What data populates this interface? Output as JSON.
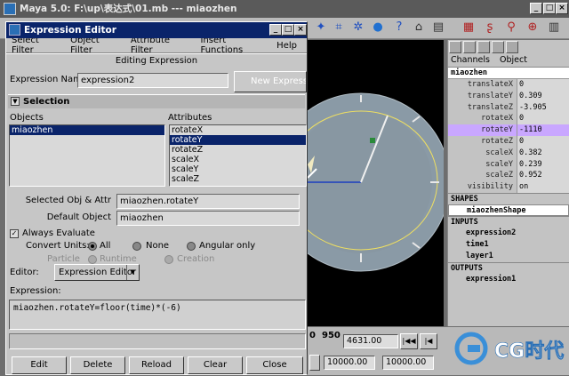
{
  "maya": {
    "title": "Maya 5.0: F:\\up\\表达式\\01.mb  ---  miaozhen",
    "win_buttons": [
      "_",
      "□",
      "×"
    ]
  },
  "toolbar_icons": [
    "object-icon",
    "render-icon",
    "graph-icon",
    "spider-icon",
    "sphere-icon",
    "light-icon",
    "help-icon",
    "reference-icon",
    "outliner-icon",
    "grid-icon",
    "channel-icon",
    "curve-icon",
    "camera-icon"
  ],
  "expression_editor": {
    "title": "Expression Editor",
    "menu": [
      "Select Filter",
      "Object Filter",
      "Attribute Filter",
      "Insert Functions",
      "Help"
    ],
    "mode_heading": "Editing Expression",
    "expression_name_label": "Expression Name",
    "expression_name_value": "expression2",
    "new_expression_button": "New Expression",
    "selection_label": "Selection",
    "objects_label": "Objects",
    "attributes_label": "Attributes",
    "objects": [
      {
        "name": "miaozhen",
        "selected": true
      }
    ],
    "attributes": [
      {
        "name": "rotateX",
        "selected": false
      },
      {
        "name": "rotateY",
        "selected": true
      },
      {
        "name": "rotateZ",
        "selected": false
      },
      {
        "name": "scaleX",
        "selected": false
      },
      {
        "name": "scaleY",
        "selected": false
      },
      {
        "name": "scaleZ",
        "selected": false
      }
    ],
    "selected_obj_attr_label": "Selected Obj & Attr",
    "selected_obj_attr_value": "miaozhen.rotateY",
    "default_object_label": "Default Object",
    "default_object_value": "miaozhen",
    "always_evaluate_label": "Always Evaluate",
    "always_evaluate_checked": true,
    "convert_units_label": "Convert Units:",
    "convert_units_options": [
      "All",
      "None",
      "Angular only"
    ],
    "convert_units_selected": "All",
    "particle_label": "Particle",
    "particle_options": [
      "Runtime",
      "Creation"
    ],
    "editor_label": "Editor:",
    "editor_value": "Expression Editor",
    "expression_label": "Expression:",
    "expression_text": "miaozhen.rotateY=floor(time)*(-6)",
    "buttons": [
      "Edit",
      "Delete",
      "Reload",
      "Clear",
      "Close"
    ]
  },
  "channel_box": {
    "menu": [
      "Channels",
      "Object"
    ],
    "node": "miaozhen",
    "channels": [
      {
        "name": "translateX",
        "value": "0",
        "selected": false
      },
      {
        "name": "translateY",
        "value": "0.309",
        "selected": false
      },
      {
        "name": "translateZ",
        "value": "-3.905",
        "selected": false
      },
      {
        "name": "rotateX",
        "value": "0",
        "selected": false
      },
      {
        "name": "rotateY",
        "value": "-1110",
        "selected": true
      },
      {
        "name": "rotateZ",
        "value": "0",
        "selected": false
      },
      {
        "name": "scaleX",
        "value": "0.382",
        "selected": false
      },
      {
        "name": "scaleY",
        "value": "0.239",
        "selected": false
      },
      {
        "name": "scaleZ",
        "value": "0.952",
        "selected": false
      },
      {
        "name": "visibility",
        "value": "on",
        "selected": false
      }
    ],
    "shapes_label": "SHAPES",
    "shapes": [
      "miaozhenShape"
    ],
    "inputs_label": "INPUTS",
    "inputs": [
      "expression2",
      "time1",
      "layer1"
    ],
    "outputs_label": "OUTPUTS",
    "outputs": [
      "expression1"
    ]
  },
  "timebar": {
    "frame_left": "0",
    "frame_right": "950",
    "current_frame": "4631.00",
    "range_start": "10000.00",
    "range_end": "10000.00"
  },
  "watermark": {
    "text": "CG时代"
  },
  "colors": {
    "title_active": "#0a246a",
    "selection": "#0a246a",
    "channel_highlight": "#c9a7ff",
    "panel_gray": "#c6c6c6"
  }
}
